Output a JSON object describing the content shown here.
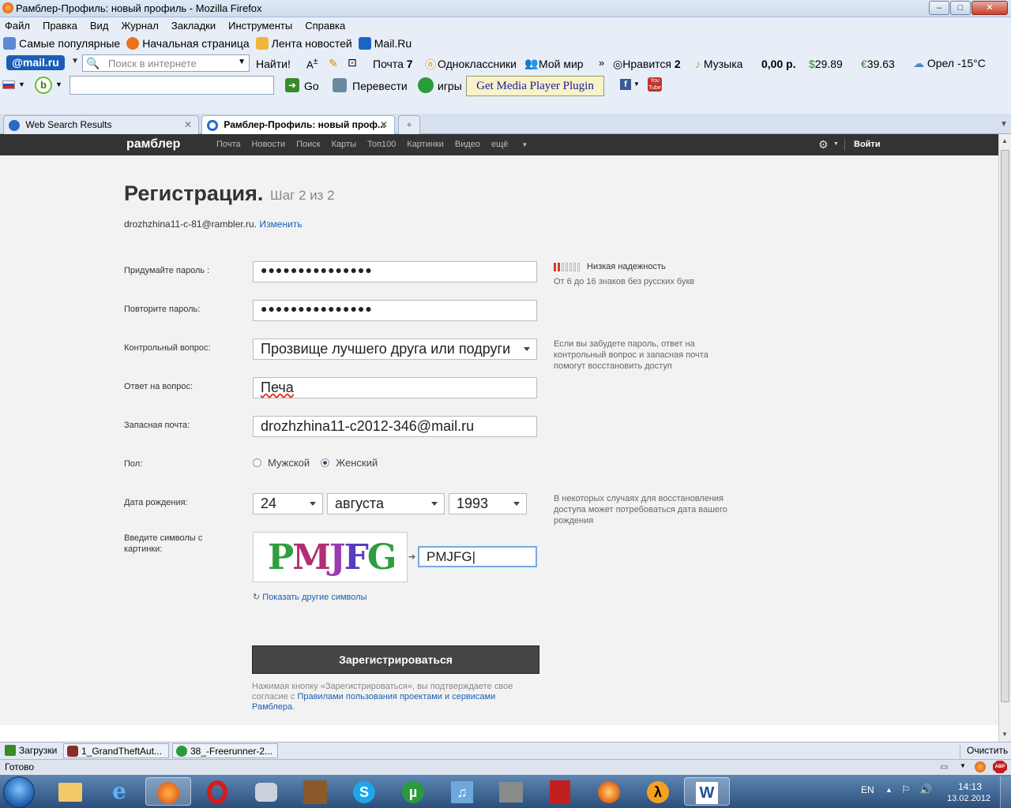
{
  "window": {
    "title": "Рамблер-Профиль: новый профиль - Mozilla Firefox"
  },
  "menu": [
    "Файл",
    "Правка",
    "Вид",
    "Журнал",
    "Закладки",
    "Инструменты",
    "Справка"
  ],
  "bookmarks": [
    "Самые популярные",
    "Начальная страница",
    "Лента новостей",
    "Mail.Ru"
  ],
  "mailbar": {
    "logo": "@mail.ru",
    "search_placeholder": "Поиск в интернете",
    "find": "Найти!",
    "mail": "Почта",
    "mail_count": "7",
    "ok": "Одноклассники",
    "moimir": "Мой мир",
    "likes": "Нравится",
    "likes_count": "2",
    "music": "Музыка",
    "balance": "0,00 р.",
    "usd": "29.89",
    "eur": "39.63",
    "weather": "Орел -15°С"
  },
  "toolbar2": {
    "go": "Go",
    "translate": "Перевести",
    "games": "игры",
    "plugin": "Get Media Player Plugin"
  },
  "tabs": [
    {
      "label": "Web Search Results"
    },
    {
      "label": "Рамблер-Профиль: новый проф..."
    }
  ],
  "header": {
    "logo": "рамблер",
    "nav": [
      "Почта",
      "Новости",
      "Поиск",
      "Карты",
      "Топ100",
      "Картинки",
      "Видео",
      "ещё"
    ],
    "login": "Войти"
  },
  "form": {
    "title": "Регистрация.",
    "step": "Шаг 2 из 2",
    "email": "drozhzhina11-c-81@rambler.ru.",
    "change": "Изменить",
    "password_label": "Придумайте пароль :",
    "password_value": "●●●●●●●●●●●●●●●",
    "strength": "Низкая надежность",
    "password_hint": "От 6 до 16 знаков без русских букв",
    "repeat_label": "Повторите пароль:",
    "repeat_value": "●●●●●●●●●●●●●●●",
    "question_label": "Контрольный вопрос:",
    "question_value": "Прозвище лучшего друга или подруги",
    "question_hint": "Если вы забудете пароль, ответ на контрольный вопрос и запасная почта помогут восстановить доступ",
    "answer_label": "Ответ на вопрос:",
    "answer_value": "Печа",
    "backup_label": "Запасная почта:",
    "backup_value": "drozhzhina11-c2012-346@mail.ru",
    "gender_label": "Пол:",
    "male": "Мужской",
    "female": "Женский",
    "birth_label": "Дата рождения:",
    "day": "24",
    "month": "августа",
    "year": "1993",
    "birth_hint": "В некоторых случаях для восстановления доступа может потребоваться дата вашего рождения",
    "captcha_label": "Введите символы с картинки:",
    "captcha_text": "PMJFG",
    "captcha_value": "PMJFG",
    "other_symbols": "Показать другие символы",
    "register": "Зарегистрироваться",
    "terms_prefix": "Нажимая кнопку «Зарегистрироваться», вы подтверждаете свое согласие с",
    "terms_link": "Правилами пользования проектами и сервисами Рамблера",
    "terms_suffix": "."
  },
  "downloads": {
    "label": "Загрузки",
    "items": [
      "1_GrandTheftAut...",
      "38_-Freerunner-2..."
    ],
    "clear": "Очистить"
  },
  "status": "Готово",
  "tray": {
    "lang": "EN",
    "time": "14:13",
    "date": "13.02.2012"
  }
}
